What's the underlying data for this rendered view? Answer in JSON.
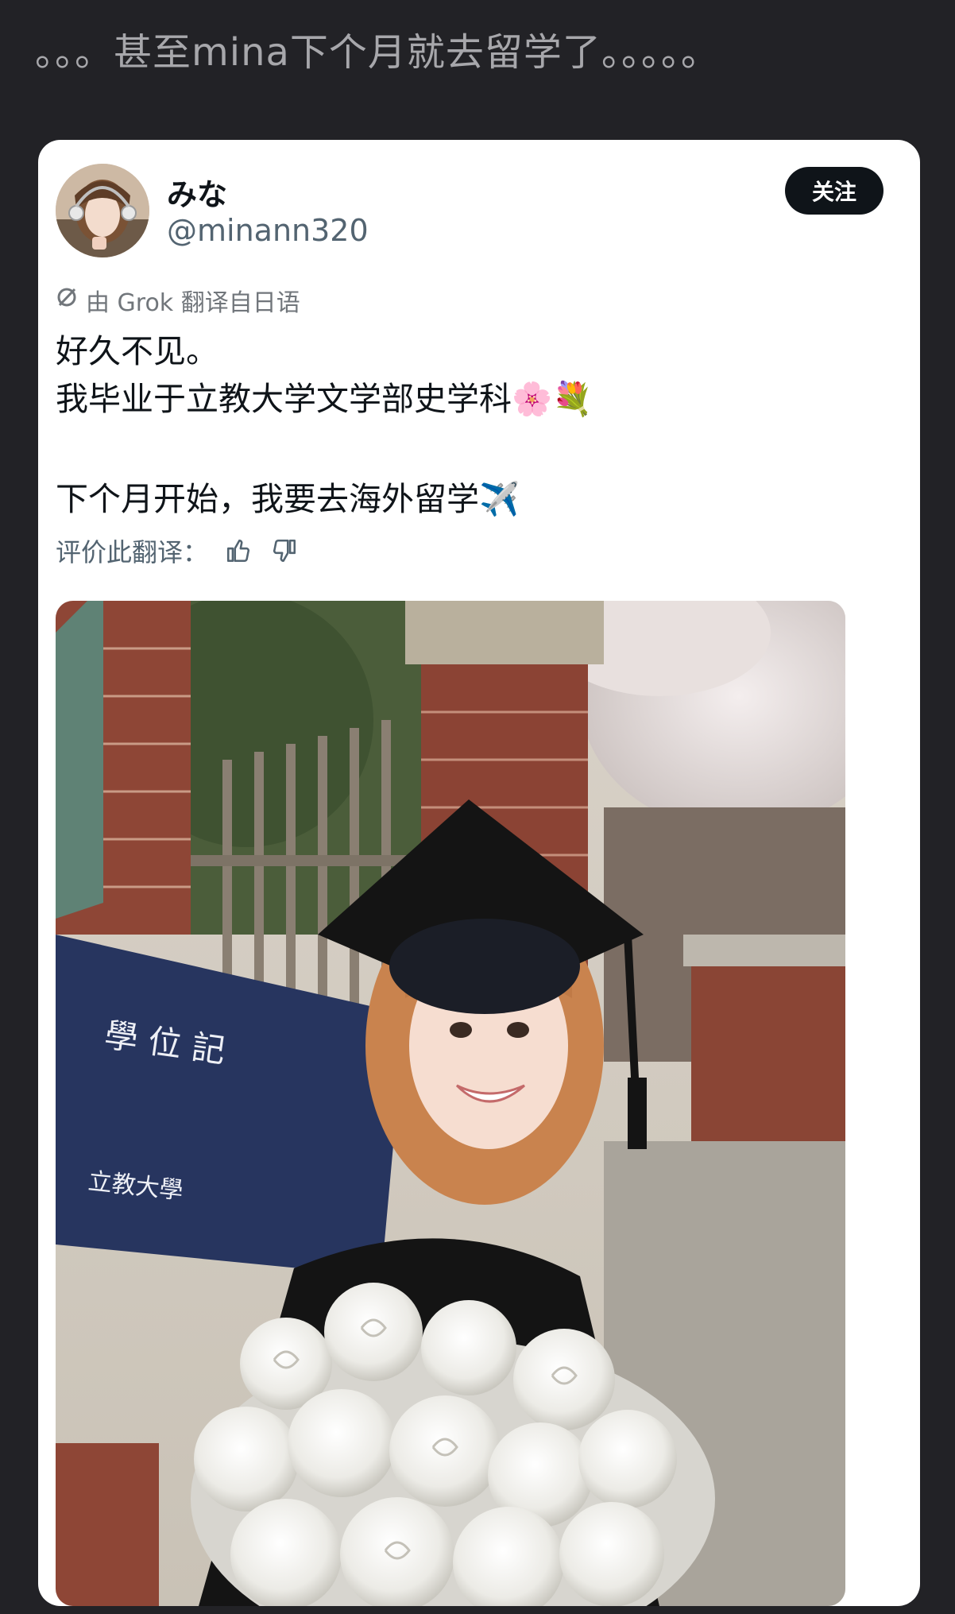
{
  "caption": "。。。甚至mina下个月就去留学了。。。。。",
  "post": {
    "display_name": "みな",
    "handle": "@minann320",
    "follow_label": "关注",
    "translation_note": "由 Grok 翻译自日语",
    "lines": [
      "好久不见。",
      "我毕业于立教大学文学部史学科🌸💐",
      "",
      "下个月开始，我要去海外留学✈️"
    ],
    "rate_label": "评价此翻译：",
    "photo": {
      "diploma_line1": "學 位 記",
      "diploma_line2": "立教大學"
    }
  },
  "colors": {
    "background": "#222226",
    "card": "#ffffff",
    "follow_button": "#0f1419",
    "secondary_text": "#536471"
  },
  "icons": [
    "grok-icon",
    "thumbs-up-icon",
    "thumbs-down-icon"
  ]
}
